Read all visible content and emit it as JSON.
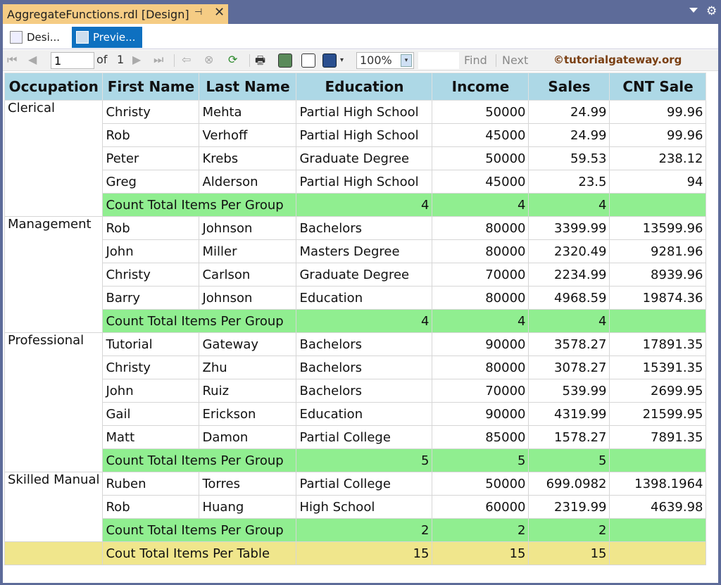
{
  "window": {
    "tab_title": "AggregateFunctions.rdl [Design]",
    "pin_glyph": "⊣",
    "close_glyph": "✕"
  },
  "mode_tabs": [
    {
      "label": "Desi..."
    },
    {
      "label": "Previe..."
    }
  ],
  "toolbar": {
    "page_value": "1",
    "of_label": "of",
    "page_total": "1",
    "zoom": "100%",
    "find_label": "Find",
    "next_label": "Next",
    "watermark": "©tutorialgateway.org"
  },
  "table": {
    "headers": [
      "Occupation",
      "First Name",
      "Last Name",
      "Education",
      "Income",
      "Sales",
      "CNT Sale"
    ],
    "groups": [
      {
        "occupation": "Clerical",
        "rows": [
          [
            "Christy",
            "Mehta",
            "Partial High School",
            "50000",
            "24.99",
            "99.96"
          ],
          [
            "Rob",
            "Verhoff",
            "Partial High School",
            "45000",
            "24.99",
            "99.96"
          ],
          [
            "Peter",
            "Krebs",
            "Graduate Degree",
            "50000",
            "59.53",
            "238.12"
          ],
          [
            "Greg",
            "Alderson",
            "Partial High School",
            "45000",
            "23.5",
            "94"
          ]
        ],
        "subtotal_label": "Count Total Items Per Group",
        "subtotals": [
          "4",
          "4",
          "4"
        ]
      },
      {
        "occupation": "Management",
        "rows": [
          [
            "Rob",
            "Johnson",
            "Bachelors",
            "80000",
            "3399.99",
            "13599.96"
          ],
          [
            "John",
            "Miller",
            "Masters Degree",
            "80000",
            "2320.49",
            "9281.96"
          ],
          [
            "Christy",
            "Carlson",
            "Graduate Degree",
            "70000",
            "2234.99",
            "8939.96"
          ],
          [
            "Barry",
            "Johnson",
            "Education",
            "80000",
            "4968.59",
            "19874.36"
          ]
        ],
        "subtotal_label": "Count Total Items Per Group",
        "subtotals": [
          "4",
          "4",
          "4"
        ]
      },
      {
        "occupation": "Professional",
        "rows": [
          [
            "Tutorial",
            "Gateway",
            "Bachelors",
            "90000",
            "3578.27",
            "17891.35"
          ],
          [
            "Christy",
            "Zhu",
            "Bachelors",
            "80000",
            "3078.27",
            "15391.35"
          ],
          [
            "John",
            "Ruiz",
            "Bachelors",
            "70000",
            "539.99",
            "2699.95"
          ],
          [
            "Gail",
            "Erickson",
            "Education",
            "90000",
            "4319.99",
            "21599.95"
          ],
          [
            "Matt",
            "Damon",
            "Partial College",
            "85000",
            "1578.27",
            "7891.35"
          ]
        ],
        "subtotal_label": "Count Total Items Per Group",
        "subtotals": [
          "5",
          "5",
          "5"
        ]
      },
      {
        "occupation": "Skilled Manual",
        "rows": [
          [
            "Ruben",
            "Torres",
            "Partial College",
            "50000",
            "699.0982",
            "1398.1964"
          ],
          [
            "Rob",
            "Huang",
            "High School",
            "60000",
            "2319.99",
            "4639.98"
          ]
        ],
        "subtotal_label": "Count Total Items Per Group",
        "subtotals": [
          "2",
          "2",
          "2"
        ]
      }
    ],
    "total_label": "Cout Total Items Per Table",
    "totals": [
      "15",
      "15",
      "15"
    ]
  },
  "colors": {
    "header": "#add8e6",
    "group_total": "#90ee90",
    "table_total": "#f0e68c",
    "active_tab": "#0e70c0",
    "doc_tab": "#f5cc84"
  }
}
